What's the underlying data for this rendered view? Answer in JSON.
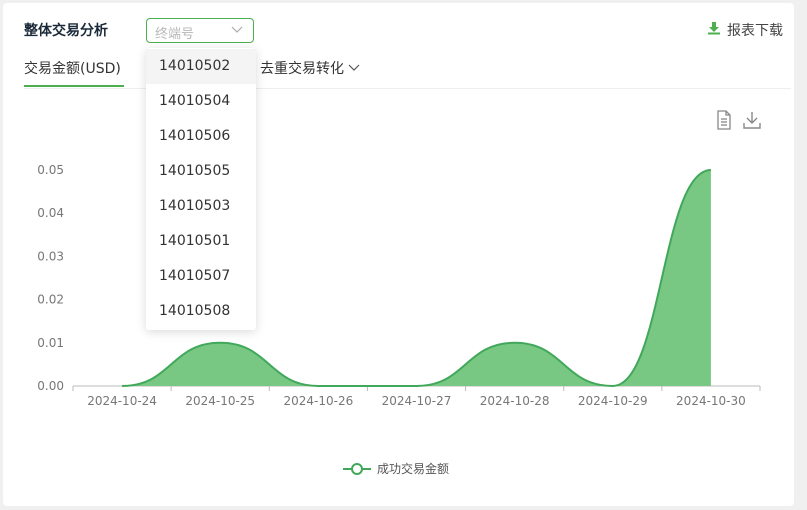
{
  "header": {
    "title": "整体交易分析",
    "terminal_placeholder": "终端号",
    "download_label": "报表下载"
  },
  "tabs": [
    {
      "label": "交易金额(USD)",
      "active": true
    },
    {
      "label": "去重交易转化",
      "active": false
    }
  ],
  "dropdown": {
    "selected": "14010502",
    "options": [
      "14010502",
      "14010504",
      "14010506",
      "14010505",
      "14010503",
      "14010501",
      "14010507",
      "14010508"
    ]
  },
  "toolbox": {
    "icons": [
      "data-view-icon",
      "save-image-icon"
    ]
  },
  "colors": {
    "accent": "#4caf50",
    "area": "#78c883",
    "line": "#41a85b"
  },
  "chart_data": {
    "type": "area",
    "x": [
      "2024-10-24",
      "2024-10-25",
      "2024-10-26",
      "2024-10-27",
      "2024-10-28",
      "2024-10-29",
      "2024-10-30"
    ],
    "series": [
      {
        "name": "成功交易金额",
        "values": [
          0,
          0.01,
          0,
          0,
          0.01,
          0,
          0.05
        ]
      }
    ],
    "ylim": [
      0,
      0.05
    ],
    "yticks": [
      "0.00",
      "0.01",
      "0.02",
      "0.03",
      "0.04",
      "0.05"
    ],
    "smooth": true,
    "legend": "bottom-center",
    "grid": false
  }
}
